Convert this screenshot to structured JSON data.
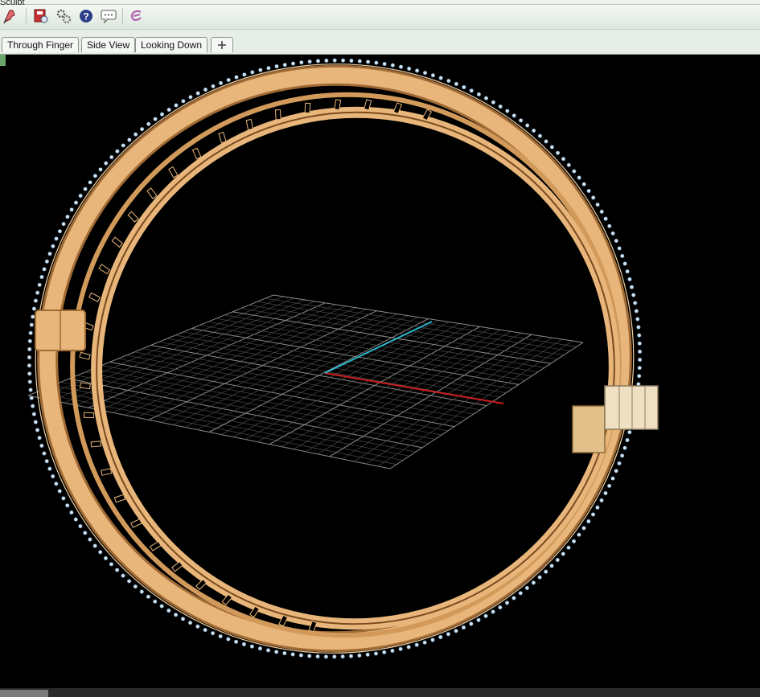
{
  "top_tab": {
    "label": "Sculpt"
  },
  "toolbar": {
    "icons": [
      "sculpt-brush-icon",
      "record-icon",
      "settings-icon",
      "help-icon",
      "comment-icon",
      "grasshopper-icon"
    ]
  },
  "viewport_tabs": [
    {
      "label": "Through Finger"
    },
    {
      "label": "Side View"
    },
    {
      "label": "Looking Down"
    }
  ],
  "add_tab": {
    "icon": "add-viewport-icon"
  },
  "colors": {
    "gold": "#e8b67a",
    "gold_dark": "#a06a35",
    "diamond": "#cfe3f2",
    "grid": "#7a7a7a",
    "axis_x": "#c81e1e",
    "axis_y": "#2ab3c8"
  }
}
